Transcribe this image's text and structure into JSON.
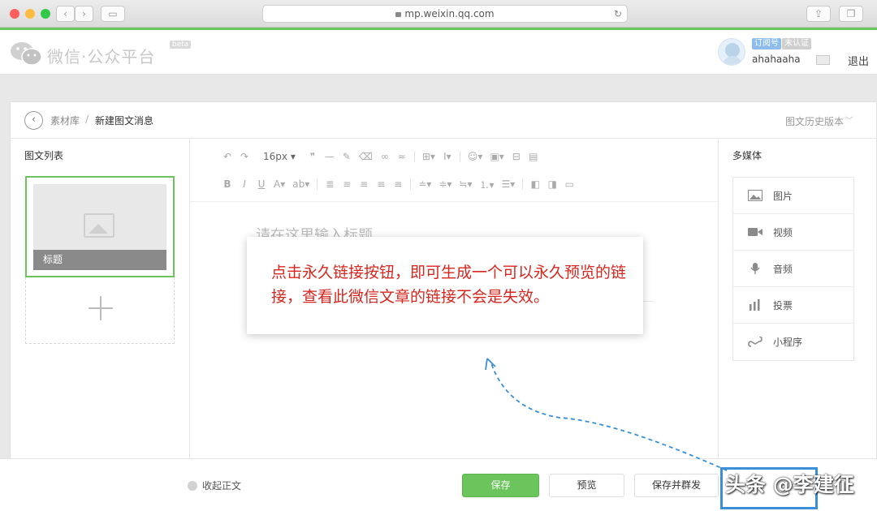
{
  "browser": {
    "url": "mp.weixin.qq.com"
  },
  "header": {
    "brand": "微信·公众平台",
    "beta": "beta",
    "badge_type": "订阅号",
    "badge_verify": "未认证",
    "username": "ahahaaha",
    "logout": "退出"
  },
  "breadcrumb": {
    "parent": "素材库",
    "separator": "/",
    "current": "新建图文消息",
    "history": "图文历史版本"
  },
  "article_list": {
    "title": "图文列表",
    "items": [
      {
        "title": "标题"
      }
    ]
  },
  "editor": {
    "font_size": "16px",
    "title_placeholder": "请在这里输入标题"
  },
  "media": {
    "title": "多媒体",
    "items": [
      {
        "label": "图片",
        "icon": "image-icon"
      },
      {
        "label": "视频",
        "icon": "video-icon"
      },
      {
        "label": "音频",
        "icon": "audio-icon"
      },
      {
        "label": "投票",
        "icon": "vote-icon"
      },
      {
        "label": "小程序",
        "icon": "miniprogram-icon"
      }
    ]
  },
  "footer": {
    "collapse": "收起正文",
    "save": "保存",
    "preview": "预览",
    "save_send": "保存并群发"
  },
  "tooltip": {
    "text": "点击永久链接按钮，即可生成一个可以永久预览的链接，查看此微信文章的链接不会是失效。"
  },
  "watermark": "头条 @李建征",
  "colors": {
    "accent_green": "#6cc55c",
    "annotation_red": "#d7261e",
    "highlight_blue": "#3a8fd8"
  }
}
